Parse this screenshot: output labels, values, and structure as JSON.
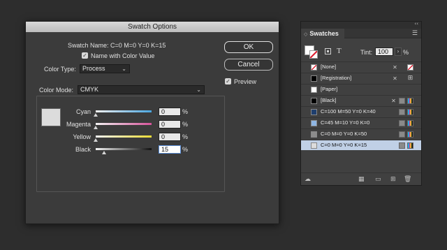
{
  "dialog": {
    "title": "Swatch Options",
    "swatch_name_label": "Swatch Name:",
    "swatch_name_value": "C=0 M=0 Y=0 K=15",
    "name_with_color_value_label": "Name with Color Value",
    "name_with_color_value_checked": true,
    "color_type_label": "Color Type:",
    "color_type_value": "Process",
    "color_mode_label": "Color Mode:",
    "color_mode_value": "CMYK",
    "ok_label": "OK",
    "cancel_label": "Cancel",
    "preview_label": "Preview",
    "preview_checked": true,
    "preview_color": "#dcdcdc",
    "sliders": [
      {
        "label": "Cyan",
        "value": "0",
        "unit": "%",
        "fraction": 0.0,
        "color": "#4aa6e0"
      },
      {
        "label": "Magenta",
        "value": "0",
        "unit": "%",
        "fraction": 0.0,
        "color": "#d6539a"
      },
      {
        "label": "Yellow",
        "value": "0",
        "unit": "%",
        "fraction": 0.0,
        "color": "#eadb36"
      },
      {
        "label": "Black",
        "value": "15",
        "unit": "%",
        "fraction": 0.15,
        "color": "#111111"
      }
    ]
  },
  "panel": {
    "title": "Swatches",
    "tint_label": "Tint:",
    "tint_value": "100",
    "tint_unit": "%",
    "menu_icon": "hamburger-icon",
    "swatches": [
      {
        "name": "[None]",
        "color": "#ffffff",
        "icons": [
          "noedit",
          "none"
        ],
        "none": true
      },
      {
        "name": "[Registration]",
        "color": "#000000",
        "icons": [
          "noedit",
          "registration"
        ]
      },
      {
        "name": "[Paper]",
        "color": "#ffffff",
        "icons": []
      },
      {
        "name": "[Black]",
        "color": "#000000",
        "icons": [
          "noedit",
          "process",
          "cmyk"
        ]
      },
      {
        "name": "C=100 M=50 Y=0 K=40",
        "color": "#1f3f6e",
        "icons": [
          "process",
          "cmyk"
        ]
      },
      {
        "name": "C=45 M=10 Y=0 K=0",
        "color": "#8fb6e3",
        "icons": [
          "process",
          "cmyk"
        ]
      },
      {
        "name": "C=0 M=0 Y=0 K=50",
        "color": "#8c8c8c",
        "icons": [
          "process",
          "cmyk"
        ]
      },
      {
        "name": "C=0 M=0 Y=0 K=15",
        "color": "#dcdcdc",
        "icons": [
          "process",
          "cmyk"
        ],
        "selected": true
      }
    ],
    "footer_icons": [
      "cloud-icon",
      "show-all-icon",
      "new-group-icon",
      "new-swatch-icon",
      "delete-icon"
    ]
  }
}
